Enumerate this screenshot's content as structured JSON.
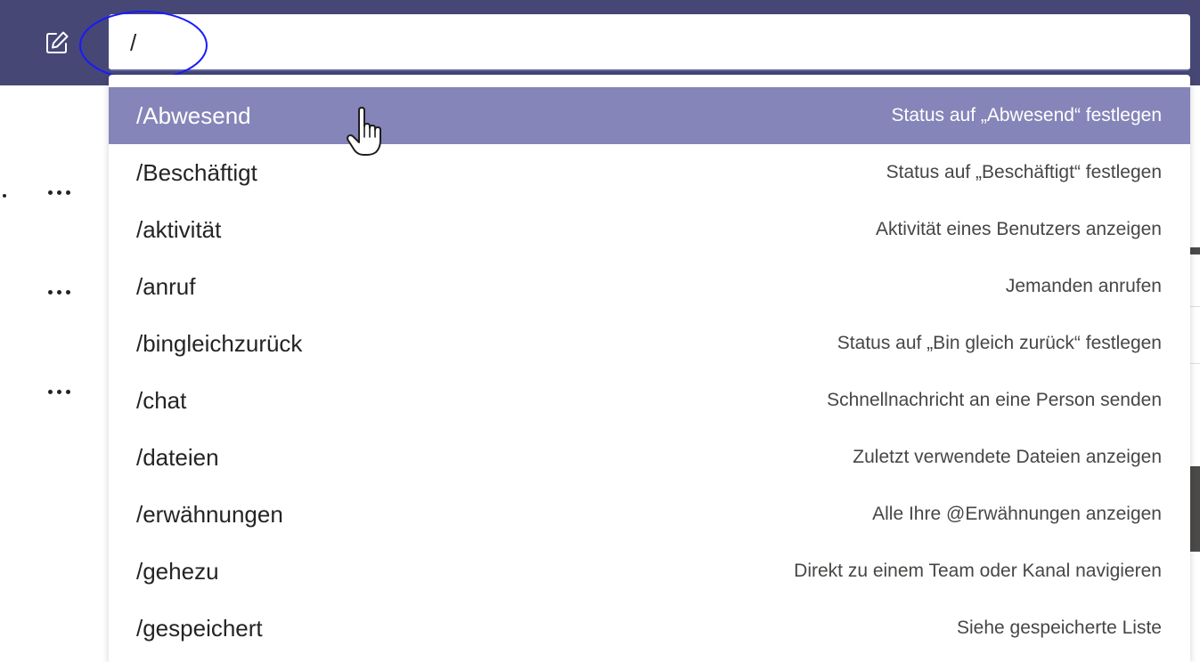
{
  "search": {
    "value": "/",
    "placeholder": ""
  },
  "commands": [
    {
      "name": "/Abwesend",
      "description": "Status auf „Abwesend“ festlegen",
      "selected": true
    },
    {
      "name": "/Beschäftigt",
      "description": "Status auf „Beschäftigt“ festlegen",
      "selected": false
    },
    {
      "name": "/aktivität",
      "description": "Aktivität eines Benutzers anzeigen",
      "selected": false
    },
    {
      "name": "/anruf",
      "description": "Jemanden anrufen",
      "selected": false
    },
    {
      "name": "/bingleichzurück",
      "description": "Status auf „Bin gleich zurück“ festlegen",
      "selected": false
    },
    {
      "name": "/chat",
      "description": "Schnellnachricht an eine Person senden",
      "selected": false
    },
    {
      "name": "/dateien",
      "description": "Zuletzt verwendete Dateien anzeigen",
      "selected": false
    },
    {
      "name": "/erwähnungen",
      "description": "Alle Ihre @Erwähnungen anzeigen",
      "selected": false
    },
    {
      "name": "/gehezu",
      "description": "Direkt zu einem Team oder Kanal navigieren",
      "selected": false
    },
    {
      "name": "/gespeichert",
      "description": "Siehe gespeicherte Liste",
      "selected": false
    }
  ],
  "colors": {
    "header": "#464775",
    "selected_row": "#8585b9",
    "highlight_ellipse": "#1a1aff"
  },
  "icons": {
    "compose": "compose-icon",
    "more": "more-options-icon",
    "cursor": "hand-pointer-icon"
  }
}
